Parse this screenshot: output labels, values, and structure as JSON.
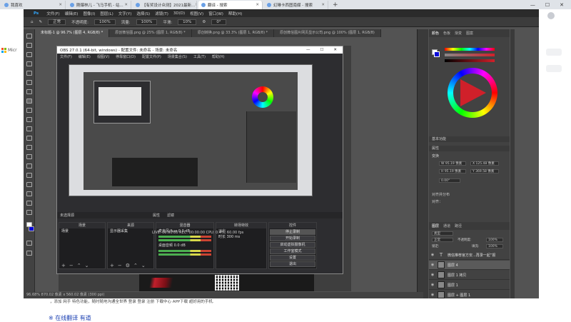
{
  "browser": {
    "tabs": [
      {
        "label": "我喜欢"
      },
      {
        "label": "刚爆林儿 - 飞马手机 - 站..."
      },
      {
        "label": "【有奖设计众测】2021最新..."
      },
      {
        "label": "翻译 - 搜索",
        "active": true
      },
      {
        "label": "幻琳卡西图南媒 - 搜索"
      }
    ],
    "new_tab": "+",
    "win_controls": [
      "—",
      "☐",
      "✕"
    ],
    "ms_text": "Micr",
    "below_text": "，添加 网手 特色功能，随时随地沟通全世界 登录 登录 注册 下载中心 APP下载 超好用的手机.",
    "below_link": "※ 在线翻译 有道"
  },
  "photoshop": {
    "menu": [
      "文件(F)",
      "编辑(E)",
      "图像(I)",
      "图层(L)",
      "文字(Y)",
      "选择(S)",
      "滤镜(T)",
      "3D(D)",
      "视图(V)",
      "窗口(W)",
      "帮助(H)"
    ],
    "logo": "Ps",
    "options": {
      "mode": "正常",
      "opacity_label": "不透明度:",
      "opacity": "100%",
      "flow_label": "流量:",
      "flow": "100%",
      "smooth_label": "平滑:",
      "smooth": "10%",
      "angle": "0°"
    },
    "doc_tabs": [
      "未标题-1 @ 96.7% (图层 4, RGB/8) *",
      "原创微信图.png @ 25% (图层 1, RGB/8) *",
      "原创转换.png @ 33.3% (图层 1, RGB/8) *",
      "原创微信图片网页显示公司.png @ 100% (图层 1, RGB/8)"
    ],
    "status": "96.68%  870.02 像素 x 560.02 像素 (300 ppi)",
    "right_tabs": [
      "颜色",
      "色板",
      "渐变",
      "图案"
    ],
    "sections": {
      "history": "基本功能",
      "properties": "属性",
      "transform": "变换",
      "align": "对齐并分布",
      "align_sub": "对齐：",
      "layers_tabs": [
        "图层",
        "通道",
        "路径"
      ]
    },
    "transform": {
      "w": "W  95.19 像素",
      "h": "H  95.19 像素",
      "x": "X  125.48 像素",
      "y": "Y  369.58 像素",
      "angle": "0.00°"
    },
    "layers": {
      "filter": "类型",
      "mode": "正常",
      "opacity_label": "不透明度:",
      "opacity": "100%",
      "lock_label": "锁定:",
      "fill_label": "填充:",
      "fill": "100%",
      "items": [
        "微信推荐官方安...再录一起”报",
        "图层 4",
        "图层 1 拷贝",
        "图层 1",
        "图层 + 图层 1"
      ]
    }
  },
  "obs": {
    "title": "OBS 27.0.1 (64-bit, windows) - 配置文件: 未命名 - 场景: 未命名",
    "menu": [
      "文件(F)",
      "编辑(E)",
      "视图(V)",
      "停靠窗口(D)",
      "配置文件(P)",
      "场景集合(S)",
      "工具(T)",
      "帮助(H)"
    ],
    "source_label": "未选择源",
    "prop_label": "属性",
    "filter_label": "滤镜",
    "docks": {
      "scenes": {
        "title": "场景",
        "rows": [
          "场景"
        ]
      },
      "sources": {
        "title": "来源",
        "rows": [
          "显示器采集"
        ]
      },
      "mixer": {
        "title": "混音器",
        "rows": [
          "麦克风/Aux",
          "桌面音频"
        ],
        "levels": [
          "0.0 dB",
          "0.0 dB"
        ]
      },
      "transitions": {
        "title": "转场特效",
        "mode": "淡出",
        "duration_label": "时长",
        "duration": "300 ms"
      },
      "controls": {
        "title": "控件",
        "buttons": [
          "停止录制",
          "开始录制",
          "启动虚拟摄像机",
          "工作室模式",
          "设置",
          "退出"
        ]
      }
    },
    "status": "LIVE: 00:00:00   REC: 00:00:00   CPU: 0.4%, 60.00 fps"
  },
  "colors": {
    "ps_bg": "#535353",
    "obs_bg": "#2d2d30",
    "accent_blue": "#31a8ff",
    "red": "#d0202a"
  }
}
